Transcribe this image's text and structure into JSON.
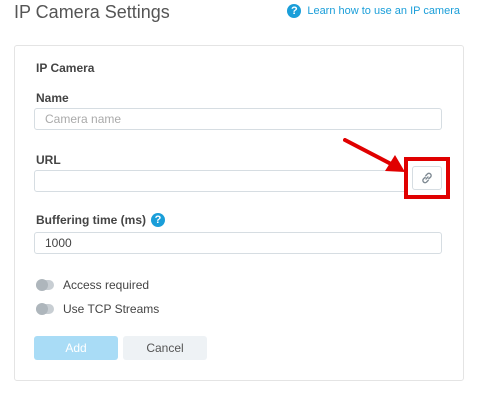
{
  "page": {
    "title": "IP Camera Settings",
    "help_link": "Learn how to use an IP camera",
    "help_icon": "question-circle-icon"
  },
  "form": {
    "section_title": "IP Camera",
    "name": {
      "label": "Name",
      "placeholder": "Camera name",
      "value": ""
    },
    "url": {
      "label": "URL",
      "value": "",
      "link_icon": "link-icon"
    },
    "buffering": {
      "label": "Buffering time (ms)",
      "value": "1000",
      "help_icon": "question-circle-icon"
    },
    "toggles": [
      {
        "label": "Access required",
        "on": false
      },
      {
        "label": "Use TCP Streams",
        "on": false
      }
    ],
    "buttons": {
      "add": "Add",
      "cancel": "Cancel"
    }
  },
  "colors": {
    "accent": "#1a9ed9",
    "highlight_frame": "#e00000",
    "add_button": "#a9dcf6",
    "cancel_button": "#eef2f5"
  }
}
